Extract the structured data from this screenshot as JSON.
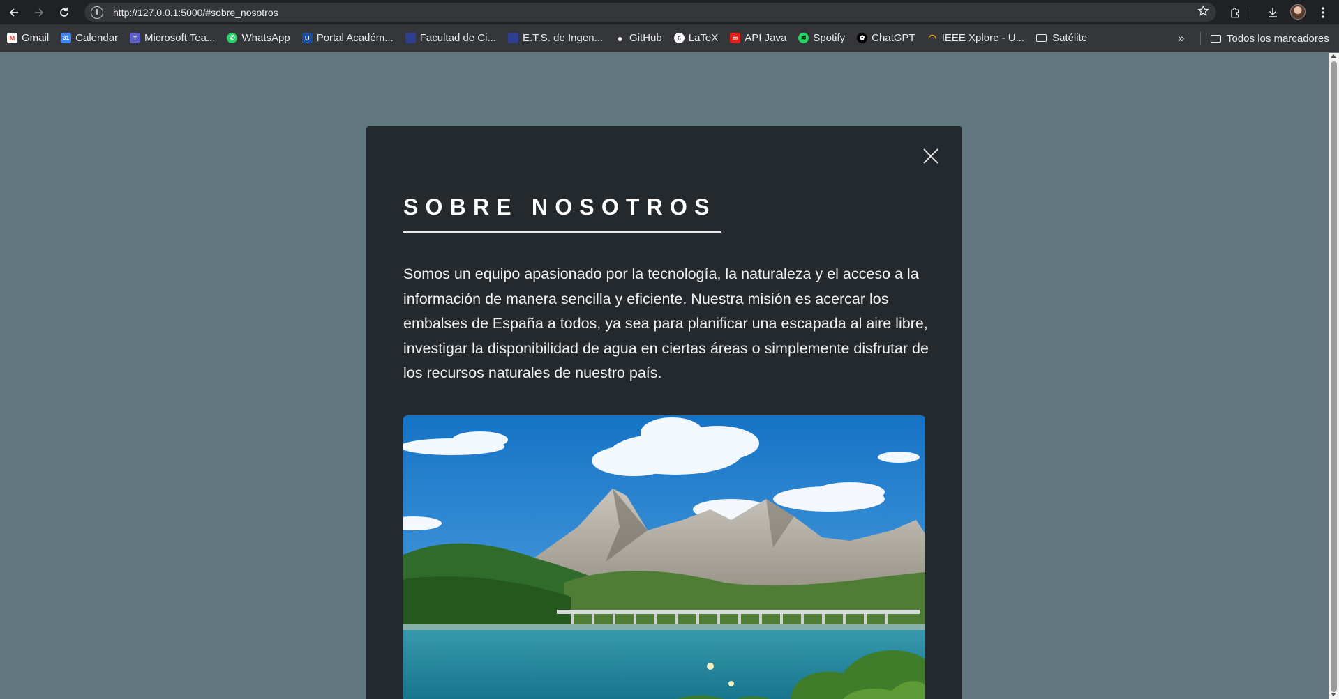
{
  "browser": {
    "url": "http://127.0.0.1:5000/#sobre_nosotros",
    "info_glyph": "i",
    "icons": [
      "back-arrow-icon",
      "forward-arrow-icon",
      "reload-icon",
      "site-info-icon",
      "bookmark-star-icon",
      "extensions-icon",
      "download-icon",
      "profile-avatar",
      "kebab-menu-icon"
    ]
  },
  "bookmarks": {
    "items": [
      {
        "label": "Gmail",
        "icon": "gmail-icon",
        "color": "#ea4335",
        "glyph": "M"
      },
      {
        "label": "Calendar",
        "icon": "calendar-icon",
        "color": "#4285f4",
        "glyph": "31"
      },
      {
        "label": "Microsoft Tea...",
        "icon": "teams-icon",
        "color": "#5b5fc7",
        "glyph": "T"
      },
      {
        "label": "WhatsApp",
        "icon": "whatsapp-icon",
        "color": "#25d366",
        "glyph": "✆"
      },
      {
        "label": "Portal Académ...",
        "icon": "university-icon",
        "color": "#1a4fa0",
        "glyph": "U"
      },
      {
        "label": "Facultad de Ci...",
        "icon": "faculty-icon",
        "color": "#2f3f8f",
        "glyph": ""
      },
      {
        "label": "E.T.S. de Ingen...",
        "icon": "ets-icon",
        "color": "#2f3f8f",
        "glyph": ""
      },
      {
        "label": "GitHub",
        "icon": "github-icon",
        "color": "#f0f0f0",
        "glyph": "●"
      },
      {
        "label": "LaTeX",
        "icon": "overleaf-icon",
        "color": "#ffffff",
        "glyph": "6"
      },
      {
        "label": "API Java",
        "icon": "oracle-icon",
        "color": "#e0201b",
        "glyph": "▭"
      },
      {
        "label": "Spotify",
        "icon": "spotify-icon",
        "color": "#1ed760",
        "glyph": "≋"
      },
      {
        "label": "ChatGPT",
        "icon": "chatgpt-icon",
        "color": "#000000",
        "glyph": "✿"
      },
      {
        "label": "IEEE Xplore - U...",
        "icon": "ieee-icon",
        "color": "#f7a31c",
        "glyph": "◠"
      },
      {
        "label": "Satélite",
        "icon": "folder-icon",
        "color": "",
        "glyph": ""
      }
    ],
    "overflow": "»",
    "all_bookmarks": "Todos los marcadores"
  },
  "modal": {
    "title": "SOBRE NOSOTROS",
    "body": "Somos un equipo apasionado por la tecnología, la naturaleza y el acceso a la información de manera sencilla y eficiente. Nuestra misión es acercar los embalses de España a todos, ya sea para planificar una escapada al aire libre, investigar la disponibilidad de agua en ciertas áreas o simplemente disfrutar de los recursos naturales de nuestro país.",
    "image_description": "reservoir-landscape-photo"
  },
  "colors": {
    "page_bg": "#617880",
    "modal_bg": "#24292d",
    "chrome_dark": "#202124",
    "bookmarks_bg": "#35363a"
  }
}
